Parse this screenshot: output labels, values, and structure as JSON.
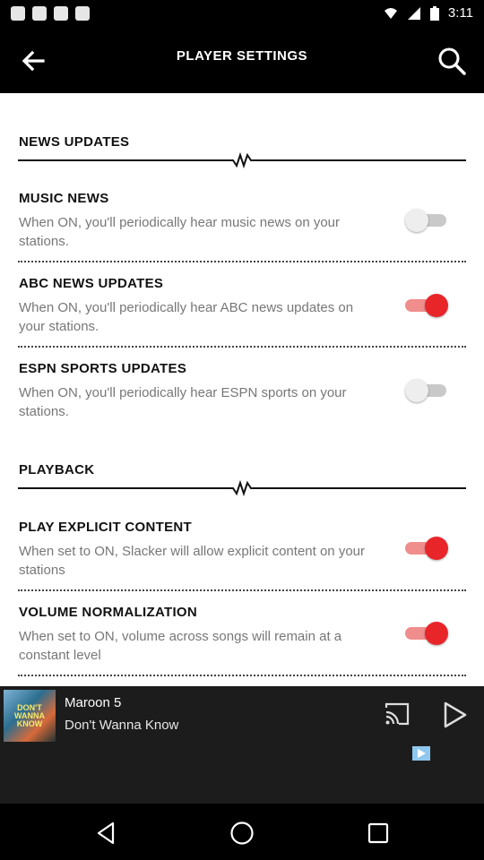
{
  "status_bar": {
    "time": "3:11"
  },
  "app_bar": {
    "title": "PLAYER SETTINGS"
  },
  "sections": [
    {
      "title": "NEWS UPDATES",
      "items": [
        {
          "title": "MUSIC NEWS",
          "desc": "When ON, you'll periodically hear music news on your stations.",
          "on": false
        },
        {
          "title": "ABC NEWS UPDATES",
          "desc": "When ON, you'll periodically hear ABC news updates on your stations.",
          "on": true
        },
        {
          "title": "ESPN SPORTS UPDATES",
          "desc": "When ON, you'll periodically hear ESPN sports on your stations.",
          "on": false
        }
      ]
    },
    {
      "title": "PLAYBACK",
      "items": [
        {
          "title": "PLAY EXPLICIT CONTENT",
          "desc": "When set to ON, Slacker will allow explicit content on your stations",
          "on": true
        },
        {
          "title": "VOLUME NORMALIZATION",
          "desc": "When set to ON, volume across songs will remain at a constant level",
          "on": true
        }
      ]
    }
  ],
  "player": {
    "artist": "Maroon 5",
    "song": "Don't Wanna Know",
    "album_art_text": "DON'T WANNA KNOW"
  },
  "colors": {
    "accent": "#e8262a",
    "accent_track": "#f08d8d",
    "bar": "#000000",
    "player_bg": "#1c1c1c"
  },
  "icons": {
    "back": "arrow-left-icon",
    "search": "search-icon",
    "cast": "cast-icon",
    "play": "play-icon",
    "nav_back": "triangle-back-icon",
    "nav_home": "circle-home-icon",
    "nav_recents": "square-recents-icon"
  }
}
